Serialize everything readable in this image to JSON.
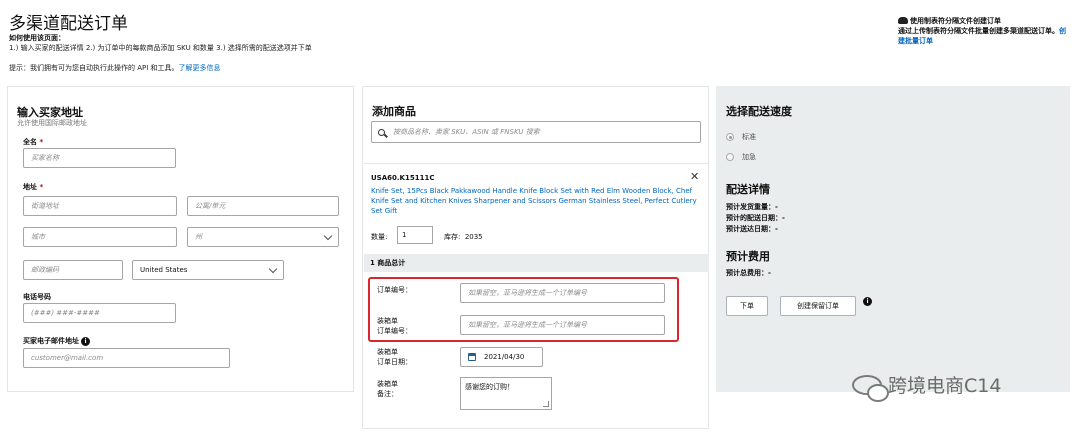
{
  "page": {
    "title": "多渠道配送订单",
    "howto_heading": "如何使用该页面：",
    "howto_steps": "1.) 输入买家的配送详情 2.) 为订单中的每款商品添加 SKU 和数量 3.) 选择所需的配送选项并下单",
    "tip_text": "提示：我们拥有可为您自动执行此操作的 API 和工具。",
    "tip_link": "了解更多信息"
  },
  "bulk": {
    "title": "使用制表符分隔文件创建订单",
    "desc": "通过上传制表符分隔文件批量创建多渠道配送订单。",
    "link": "创建批量订单"
  },
  "buyer": {
    "heading": "输入买家地址",
    "subheading": "允许使用国际邮政地址",
    "fullname_label": "全名",
    "fullname_placeholder": "买家名称",
    "address_label": "地址",
    "street_placeholder": "街道地址",
    "apt_placeholder": "公寓/单元",
    "city_placeholder": "城市",
    "state_placeholder": "州",
    "zip_placeholder": "邮政编码",
    "country_value": "United States",
    "phone_label": "电话号码",
    "phone_placeholder": "(###) ###-####",
    "email_label": "买家电子邮件地址",
    "email_placeholder": "customer@mail.com"
  },
  "items": {
    "heading": "添加商品",
    "search_placeholder": "按商品名称、卖家 SKU、ASIN 或 FNSKU 搜索",
    "sku": "USA60.K15111C",
    "product_title": "Knife Set, 15Pcs Black Pakkawood Handle Knife Block Set with Red Elm Wooden Block, Chef Knife Set and Kitchen Knives Sharpener and Scissors German Stainless Steel, Perfect Cutlery Set Gift",
    "qty_label": "数量:",
    "qty_value": "1",
    "stock_label": "库存:",
    "stock_value": "2035",
    "total_label": "1 商品总计",
    "order_no_label": "订单编号：",
    "order_no_placeholder": "如果留空，亚马逊将生成一个订单编号",
    "packing_no_label_1": "装箱单",
    "packing_no_label_2": "订单编号：",
    "packing_no_placeholder": "如果留空，亚马逊将生成一个订单编号",
    "packing_date_label_1": "装箱单",
    "packing_date_label_2": "订单日期：",
    "packing_date_value": "2021/04/30",
    "packing_note_label_1": "装箱单",
    "packing_note_label_2": "备注：",
    "packing_note_value": "感谢您的订购！"
  },
  "speed": {
    "heading": "选择配送速度",
    "option_standard": "标准",
    "option_expedited": "加急",
    "details_heading": "配送详情",
    "ship_weight": "预计发货重量：-",
    "arrival_date": "预计的配送日期：-",
    "delivery_date": "预计送达日期：-",
    "cost_heading": "预计费用",
    "total_cost": "预计总费用：-",
    "place_order": "下单",
    "create_hold": "创建保留订单"
  },
  "watermark": {
    "text": "跨境电商C14"
  },
  "colors": {
    "link": "#0066c0",
    "highlight": "#d9262e",
    "panel_gray": "#eaeded"
  }
}
